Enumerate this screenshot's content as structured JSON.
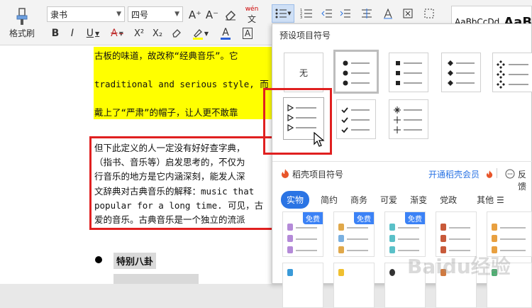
{
  "toolbar": {
    "format_painter_label": "格式刷",
    "font_name": "隶书",
    "font_size": "四号",
    "pinyin_label": "wén",
    "bold": "B",
    "italic": "I",
    "underline": "U",
    "strike": "A",
    "superscript": "X²",
    "subscript": "X₂",
    "font_color": "A",
    "char_border": "A",
    "grow_font": "A⁺",
    "shrink_font": "A⁻",
    "style_sample_1": "AaBbCcDd",
    "style_sample_2": "AaB"
  },
  "document": {
    "lines_yellow": [
      "古板的味道，故改称“经典音乐”。它",
      "traditional and serious style, 而",
      "戴上了“严肃”的帽子，让人更不敢靠"
    ],
    "lines_red": [
      "但下此定义的人一定没有好好查字典，",
      "（指书、音乐等）启发思考的，不仅为",
      "行音乐的地方是它内涵深刻，能发人深",
      "文辞典对古典音乐的解释：music that",
      "popular for a long time. 可见，古",
      "爱的音乐。古典音乐是一个独立的流派"
    ],
    "heading": "特别八卦"
  },
  "dropdown": {
    "preset_title": "预设项目符号",
    "none_label": "无",
    "wps_title": "稻壳项目符号",
    "member_link": "开通稻壳会员",
    "feedback": "反馈",
    "tabs": [
      "实物",
      "简约",
      "商务",
      "可爱",
      "渐变",
      "党政"
    ],
    "more_label": "其他",
    "free_badge": "免费"
  },
  "colors": {
    "accent": "#2b74e4",
    "highlight": "#ffff00",
    "annotation_red": "#e02020",
    "member_orange": "#e8552a"
  },
  "watermark": "Baidu经验"
}
